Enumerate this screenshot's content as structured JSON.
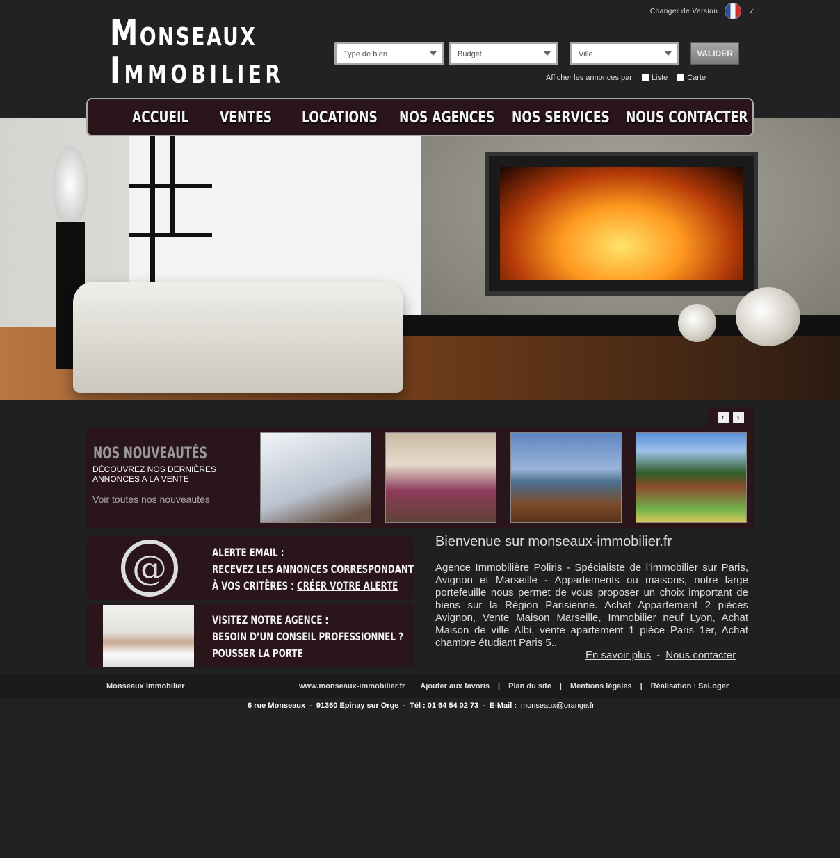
{
  "brand": {
    "logo_line1_first": "M",
    "logo_line1_rest": "ONSEAUX",
    "logo_line2_first": "I",
    "logo_line2_rest": "MMOBILIER"
  },
  "version": {
    "label": "Changer de Version",
    "flag_icon": "france-flag-icon"
  },
  "search": {
    "type_placeholder": "Type de bien",
    "budget_placeholder": "Budget",
    "city_placeholder": "Ville",
    "submit_label": "VALIDER",
    "display_label": "Afficher les annonces par",
    "option_list": "Liste",
    "option_map": "Carte"
  },
  "nav": {
    "items": [
      {
        "label": "ACCUEIL"
      },
      {
        "label": "VENTES"
      },
      {
        "label": "LOCATIONS"
      },
      {
        "label": "NOS AGENCES"
      },
      {
        "label": "NOS SERVICES"
      },
      {
        "label": "NOUS CONTACTER"
      }
    ]
  },
  "carousel": {
    "prev_icon": "chevron-left-icon",
    "next_icon": "chevron-right-icon",
    "prev_glyph": "‹",
    "next_glyph": "›"
  },
  "news": {
    "title": "NOS NOUVEAUTÉS",
    "subtitle": "DÉCOUVREZ NOS DERNIÈRES ANNONCES A LA VENTE",
    "link": "Voir toutes nos nouveautés"
  },
  "promo_email": {
    "icon": "at-sign-icon",
    "icon_glyph": "@",
    "line1": "ALERTE EMAIL :",
    "line2": "RECEVEZ LES ANNONCES CORRESPONDANT",
    "line3_prefix": "À VOS CRITÈRES : ",
    "line3_link": "CRÉER VOTRE ALERTE"
  },
  "promo_agence": {
    "line1": "VISITEZ NOTRE AGENCE :",
    "line2": "BESOIN D’UN CONSEIL PROFESSIONNEL ?",
    "line3_link": "POUSSER LA PORTE"
  },
  "welcome": {
    "title": "Bienvenue sur monseaux-immobilier.fr",
    "body": "Agence Immobilière Poliris - Spécialiste de l’immobilier sur Paris, Avignon et Marseille - Appartements ou maisons, notre large portefeuille nous permet de vous proposer un choix important de biens sur la Région Parisienne. Achat Appartement 2 pièces Avignon, Vente Maison Marseille, Immobilier neuf Lyon, Achat Maison de ville Albi, vente apartement 1 pièce Paris 1er, Achat chambre étudiant Paris 5..",
    "link_more": "En savoir plus",
    "separator": "-",
    "link_contact": "Nous contacter"
  },
  "footer": {
    "brand": "Monseaux Immobilier",
    "links": [
      "www.monseaux-immobilier.fr",
      "Ajouter aux favoris",
      "Plan du site",
      "Mentions légales",
      "Réalisation : SeLoger"
    ],
    "separator": "|",
    "address": "6 rue Monseaux",
    "address_sep": "-",
    "city": "91360 Epinay sur Orge",
    "phone": "Tél : 01 64 54 02 73",
    "email_label": "E-Mail :",
    "email": "monseaux@orange.fr"
  }
}
